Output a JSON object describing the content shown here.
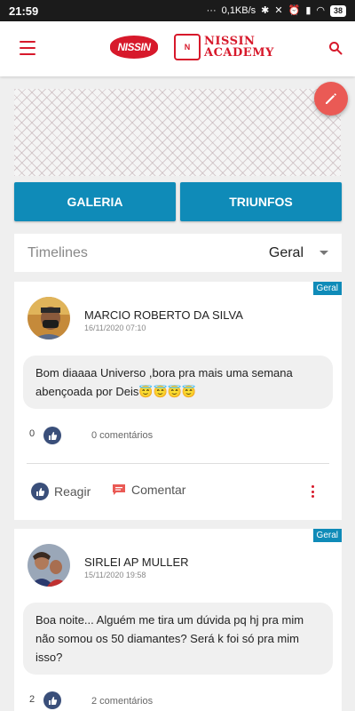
{
  "status_bar": {
    "time": "21:59",
    "speed": "0,1KB/s",
    "battery": "38"
  },
  "header": {
    "brand_logo": "NISSIN",
    "academy_logo": {
      "line1": "NISSIN",
      "line2": "ACADEMY"
    },
    "emblem": "N"
  },
  "tabs": {
    "galeria": "GALERIA",
    "triunfos": "TRIUNFOS"
  },
  "timeline": {
    "label": "Timelines",
    "selected": "Geral"
  },
  "posts": [
    {
      "tag": "Geral",
      "author": "MARCIO ROBERTO DA SILVA",
      "date": "16/11/2020 07:10",
      "text": "Bom diaaaa Universo ,bora pra mais uma semana abençoada por Deis😇😇😇😇",
      "likes": "0",
      "comments": "0 comentários",
      "react_label": "Reagir",
      "comment_label": "Comentar"
    },
    {
      "tag": "Geral",
      "author": "SIRLEI AP MULLER",
      "date": "15/11/2020 19:58",
      "text": "Boa noite... Alguém me tira um dúvida pq hj pra mim não somou os 50 diamantes? Será k foi só pra mim isso?",
      "likes": "2",
      "comments": "2 comentários"
    }
  ],
  "colors": {
    "brand_red": "#d7192b",
    "accent_blue": "#0f8bb8",
    "fab": "#ea5a55"
  }
}
